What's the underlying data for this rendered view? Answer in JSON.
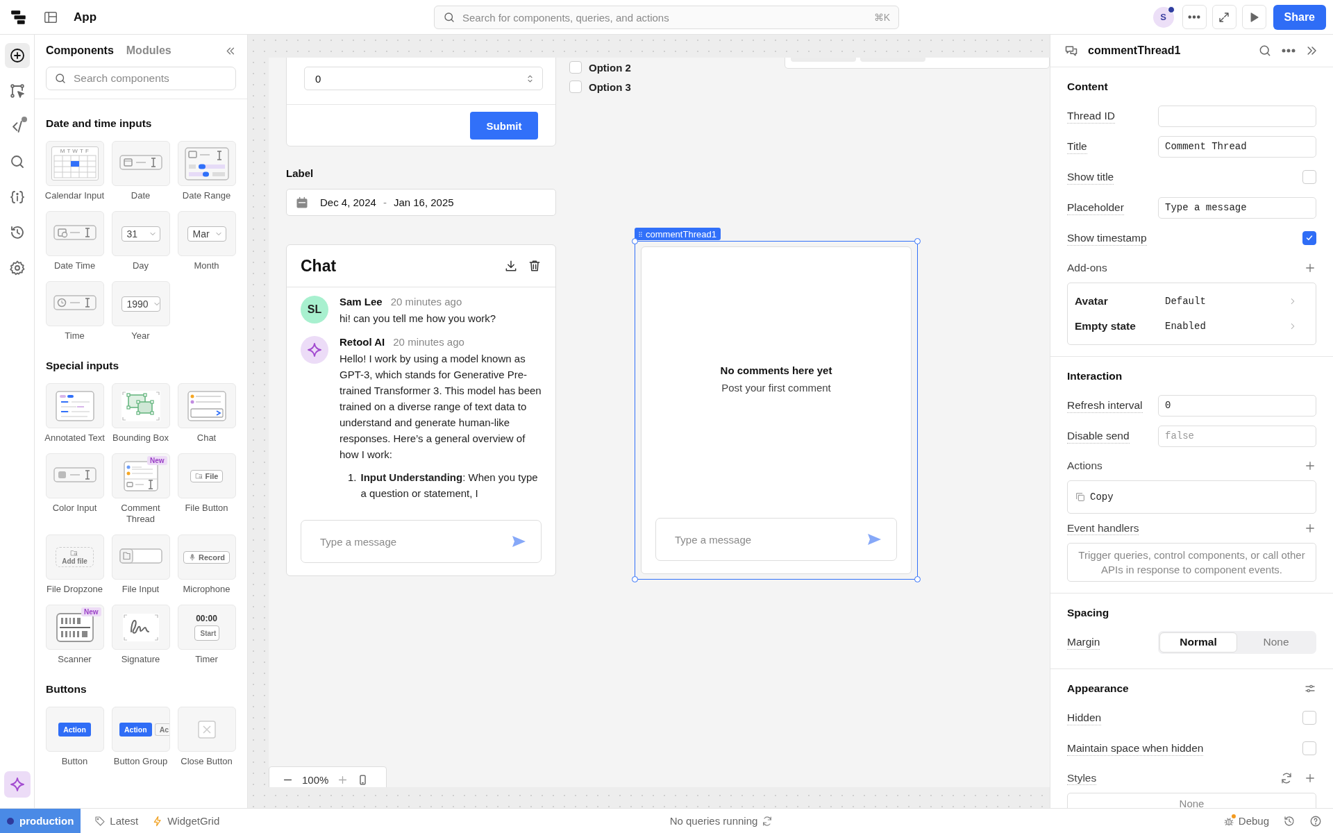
{
  "topbar": {
    "app_name": "App",
    "search": {
      "placeholder": "Search for components, queries, and actions",
      "shortcut": "⌘K"
    },
    "avatar": {
      "initial": "S",
      "online": true
    },
    "share": "Share"
  },
  "rail": {
    "items": [
      {
        "selected": true,
        "notification": false
      },
      {
        "selected": false,
        "notification": false
      },
      {
        "selected": false,
        "notification": true
      },
      {
        "selected": false,
        "notification": false
      },
      {
        "selected": false,
        "notification": false
      },
      {
        "selected": false,
        "notification": false
      },
      {
        "selected": false,
        "notification": false
      }
    ]
  },
  "components_panel": {
    "tabs": [
      {
        "label": "Components",
        "selected": true
      },
      {
        "label": "Modules",
        "selected": false
      }
    ],
    "search": {
      "placeholder": "Search components"
    },
    "sections": [
      {
        "title": "Date and time inputs",
        "items": [
          {
            "label": "Calendar Input",
            "kind": "calendar",
            "texts": [
              "M T W T F"
            ]
          },
          {
            "label": "Date",
            "kind": "date"
          },
          {
            "label": "Date Range",
            "kind": "date_range"
          },
          {
            "label": "Date Time",
            "kind": "date_time"
          },
          {
            "label": "Day",
            "kind": "select",
            "texts": [
              "31"
            ]
          },
          {
            "label": "Month",
            "kind": "select",
            "texts": [
              "Mar"
            ]
          },
          {
            "label": "Time",
            "kind": "time"
          },
          {
            "label": "Year",
            "kind": "select",
            "texts": [
              "1990"
            ]
          }
        ]
      },
      {
        "title": "Special inputs",
        "items": [
          {
            "label": "Annotated Text",
            "kind": "annotated"
          },
          {
            "label": "Bounding Box",
            "kind": "bbox"
          },
          {
            "label": "Chat",
            "kind": "chat"
          },
          {
            "label": "Color Input",
            "kind": "color"
          },
          {
            "label": "Comment Thread",
            "kind": "comment",
            "badge": "New"
          },
          {
            "label": "File Button",
            "kind": "file_button",
            "texts": [
              "File"
            ]
          },
          {
            "label": "File Dropzone",
            "kind": "dropzone",
            "texts": [
              "Add file"
            ]
          },
          {
            "label": "File Input",
            "kind": "file_input"
          },
          {
            "label": "Microphone",
            "kind": "microphone",
            "texts": [
              "Record"
            ]
          },
          {
            "label": "Scanner",
            "kind": "scanner",
            "badge": "New"
          },
          {
            "label": "Signature",
            "kind": "signature"
          },
          {
            "label": "Timer",
            "kind": "timer",
            "texts": [
              "00:00",
              "Start"
            ]
          }
        ]
      },
      {
        "title": "Buttons",
        "items": [
          {
            "label": "Button",
            "kind": "button",
            "texts": [
              "Action"
            ]
          },
          {
            "label": "Button Group",
            "kind": "button_group",
            "texts": [
              "Action",
              "Ac"
            ]
          },
          {
            "label": "Close Button",
            "kind": "close"
          }
        ]
      }
    ]
  },
  "canvas": {
    "form": {
      "number_value": "0",
      "submit": "Submit"
    },
    "checkboxes": [
      {
        "label": "Option 2",
        "checked": false
      },
      {
        "label": "Option 3",
        "checked": false
      }
    ],
    "date_range": {
      "label": "Label",
      "start": "Dec 4, 2024",
      "separator": "-",
      "end": "Jan 16, 2025"
    },
    "chat": {
      "title": "Chat",
      "messages": [
        {
          "author": "Sam Lee",
          "kind": "user",
          "initials": "SL",
          "time": "20 minutes ago",
          "paragraphs": [
            "hi! can you tell me how you work?"
          ]
        },
        {
          "author": "Retool AI",
          "kind": "assistant",
          "time": "20 minutes ago",
          "paragraphs": [
            "Hello! I work by using a model known as GPT-3, which stands for Generative Pre-trained Transformer 3. This model has been trained on a diverse range of text data to understand and generate human-like responses. Here’s a general overview of how I work:"
          ],
          "list": [
            {
              "number": "1.",
              "text": "**Input Understanding**: When you type a question or statement, I"
            }
          ]
        }
      ],
      "input_placeholder": "Type a message"
    },
    "comment_thread": {
      "tag": "commentThread1",
      "selected": true,
      "empty_title": "No comments here yet",
      "empty_subtitle": "Post your first comment",
      "input_placeholder": "Type a message"
    },
    "zoom": {
      "value": "100%"
    }
  },
  "inspector": {
    "title": "commentThread1",
    "sections": [
      {
        "title": "Content",
        "rows": [
          {
            "kind": "input",
            "label": "Thread ID"
          },
          {
            "kind": "input",
            "label": "Title",
            "value": "Comment Thread"
          },
          {
            "kind": "checkbox",
            "label": "Show title",
            "checked": false
          },
          {
            "kind": "input",
            "label": "Placeholder",
            "value": "Type a message"
          },
          {
            "kind": "checkbox",
            "label": "Show timestamp",
            "checked": true
          },
          {
            "kind": "addons",
            "label": "Add-ons",
            "items": [
              {
                "name": "Avatar",
                "value": "Default"
              },
              {
                "name": "Empty state",
                "value": "Enabled"
              }
            ]
          }
        ]
      },
      {
        "title": "Interaction",
        "rows": [
          {
            "kind": "input",
            "label": "Refresh interval",
            "value": "0"
          },
          {
            "kind": "input",
            "label": "Disable send",
            "placeholder": "false"
          },
          {
            "kind": "actions",
            "label": "Actions",
            "items": [
              {
                "name": "Copy"
              }
            ]
          },
          {
            "kind": "empty_list",
            "label": "Event handlers",
            "text": "Trigger queries, control components, or call other APIs in response to component events."
          }
        ]
      },
      {
        "title": "Spacing",
        "rows": [
          {
            "kind": "segmented",
            "label": "Margin",
            "options": [
              {
                "label": "Normal",
                "selected": true
              },
              {
                "label": "None",
                "selected": false
              }
            ]
          }
        ]
      },
      {
        "title": "Appearance",
        "settings_icon": true,
        "rows": [
          {
            "kind": "checkbox",
            "label": "Hidden",
            "checked": false
          },
          {
            "kind": "checkbox",
            "label": "Maintain space when hidden",
            "checked": false
          },
          {
            "kind": "styles",
            "label": "Styles",
            "placeholder": "None"
          }
        ]
      }
    ]
  },
  "status_bar": {
    "environment": "production",
    "branch": "Latest",
    "app": "WidgetGrid",
    "queries": "No queries running",
    "debug": "Debug",
    "debug_alert": true
  }
}
